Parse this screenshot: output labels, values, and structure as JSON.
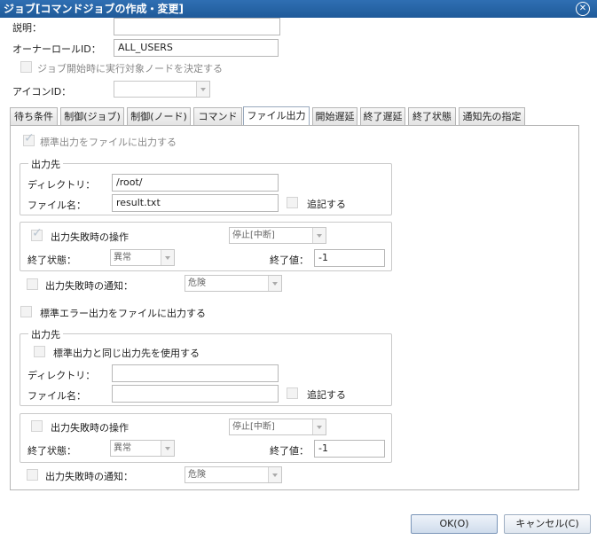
{
  "window": {
    "title": "ジョブ[コマンドジョブの作成・変更]",
    "close_icon": "close-icon"
  },
  "general": {
    "description_label": "説明：",
    "description_value": "",
    "owner_role_label": "オーナーロールID：",
    "owner_role_value": "ALL_USERS",
    "decide_node_label": "ジョブ開始時に実行対象ノードを決定する",
    "icon_id_label": "アイコンID："
  },
  "tabs": [
    "待ち条件",
    "制御(ジョブ)",
    "制御(ノード)",
    "コマンド",
    "ファイル出力",
    "開始遅延",
    "終了遅延",
    "終了状態",
    "通知先の指定"
  ],
  "active_tab": "ファイル出力",
  "stdout": {
    "enable_label": "標準出力をファイルに出力する",
    "output_legend": "出力先",
    "directory_label": "ディレクトリ：",
    "directory_value": "/root/",
    "filename_label": "ファイル名：",
    "filename_value": "result.txt",
    "append_label": "追記する",
    "fail_op_label": "出力失敗時の操作",
    "fail_op_value": "停止[中断]",
    "end_status_label": "終了状態：",
    "end_status_value": "異常",
    "end_value_label": "終了値：",
    "end_value": "-1",
    "fail_notify_label": "出力失敗時の通知：",
    "fail_notify_value": "危険"
  },
  "stderr": {
    "enable_label": "標準エラー出力をファイルに出力する",
    "output_legend": "出力先",
    "same_as_stdout_label": "標準出力と同じ出力先を使用する",
    "directory_label": "ディレクトリ：",
    "directory_value": "",
    "filename_label": "ファイル名：",
    "filename_value": "",
    "append_label": "追記する",
    "fail_op_label": "出力失敗時の操作",
    "fail_op_value": "停止[中断]",
    "end_status_label": "終了状態：",
    "end_status_value": "異常",
    "end_value_label": "終了値：",
    "end_value": "-1",
    "fail_notify_label": "出力失敗時の通知：",
    "fail_notify_value": "危険"
  },
  "buttons": {
    "ok_label": "OK(O)",
    "cancel_label": "キャンセル(C)"
  },
  "colors": {
    "title_bar": "#2f6fb3",
    "accent": "#7a95b8"
  }
}
